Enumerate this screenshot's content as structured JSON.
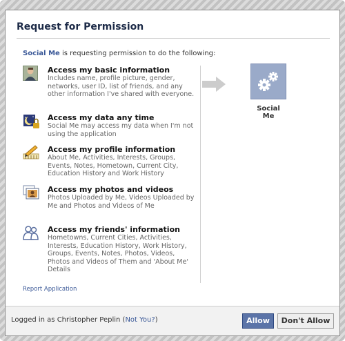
{
  "dialog": {
    "title": "Request for Permission",
    "intro_app": "Social Me",
    "intro_text": " is requesting permission to do the following:"
  },
  "permissions": [
    {
      "icon": "profile-photo-icon",
      "title": "Access my basic information",
      "desc": "Includes name, profile picture, gender, networks, user ID, list of friends, and any other information I've shared with everyone."
    },
    {
      "icon": "offline-access-icon",
      "title": "Access my data any time",
      "desc": "Social Me may access my data when I'm not using the application"
    },
    {
      "icon": "profile-edit-icon",
      "title": "Access my profile information",
      "desc": "About Me, Activities, Interests, Groups, Events, Notes, Hometown, Current City, Education History and Work History"
    },
    {
      "icon": "photos-icon",
      "title": "Access my photos and videos",
      "desc": "Photos Uploaded by Me, Videos Uploaded by Me and Photos and Videos of Me"
    },
    {
      "icon": "friends-icon",
      "title": "Access my friends' information",
      "desc": "Hometowns, Current Cities, Activities, Interests, Education History, Work History, Groups, Events, Notes, Photos, Videos, Photos and Videos of Them and 'About Me' Details"
    }
  ],
  "app": {
    "name": "Social Me",
    "icon": "gears-icon",
    "tile_color": "#9aaac9"
  },
  "report_link": "Report Application",
  "footer": {
    "logged_in_text": "Logged in as Christopher Peplin (",
    "not_you": "Not You?",
    "close_paren": ")",
    "allow": "Allow",
    "deny": "Don't Allow"
  },
  "colors": {
    "accent": "#3b5998",
    "allow_button": "#5b74a8"
  }
}
